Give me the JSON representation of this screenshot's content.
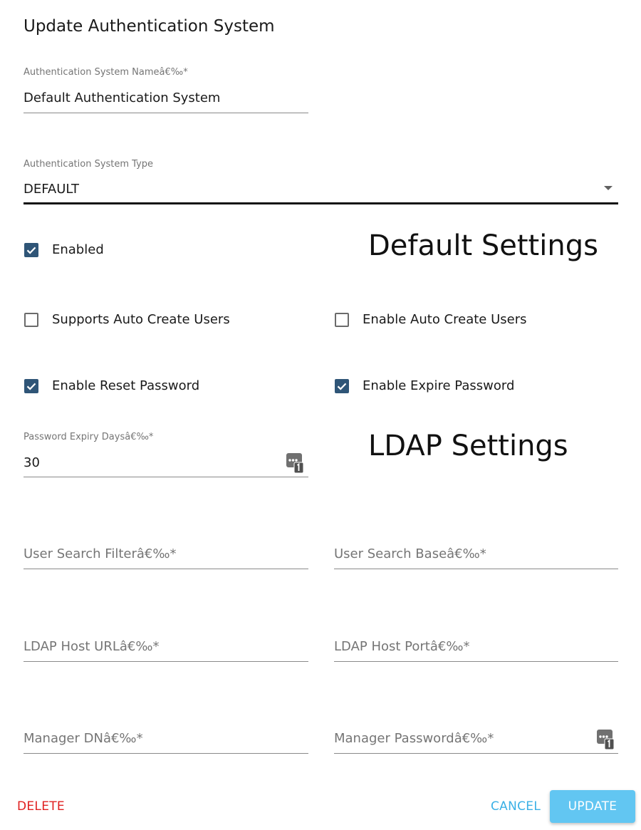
{
  "dialog": {
    "title": "Update Authentication System"
  },
  "name_field": {
    "label": "Authentication System Nameâ€‰*",
    "value": "Default Authentication System"
  },
  "type_field": {
    "label": "Authentication System Type",
    "value": "DEFAULT"
  },
  "checkboxes": {
    "enabled": {
      "label": "Enabled",
      "checked": true
    },
    "supports_auto_create": {
      "label": "Supports Auto Create Users",
      "checked": false
    },
    "enable_auto_create": {
      "label": "Enable Auto Create Users",
      "checked": false
    },
    "enable_reset_password": {
      "label": "Enable Reset Password",
      "checked": true
    },
    "enable_expire_password": {
      "label": "Enable Expire Password",
      "checked": true
    }
  },
  "sections": {
    "default": "Default Settings",
    "ldap": "LDAP Settings"
  },
  "expiry_field": {
    "label": "Password Expiry Daysâ€‰*",
    "value": "30"
  },
  "ldap": {
    "user_search_filter": {
      "placeholder": "User Search Filterâ€‰*"
    },
    "user_search_base": {
      "placeholder": "User Search Baseâ€‰*"
    },
    "host_url": {
      "placeholder": "LDAP Host URLâ€‰*"
    },
    "host_port": {
      "placeholder": "LDAP Host Portâ€‰*"
    },
    "manager_dn": {
      "placeholder": "Manager DNâ€‰*"
    },
    "manager_password": {
      "placeholder": "Manager Passwordâ€‰*"
    }
  },
  "actions": {
    "delete": "DELETE",
    "cancel": "CANCEL",
    "update": "UPDATE"
  },
  "colors": {
    "accent": "#2f5577",
    "danger": "#e02020",
    "link": "#3ab0e6",
    "primary_button": "#62c6f2"
  }
}
